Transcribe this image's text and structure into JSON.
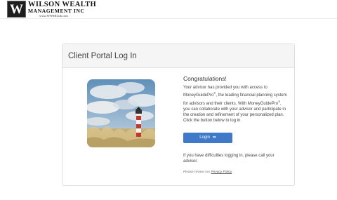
{
  "header": {
    "logo_mark": "W",
    "logo_line1": "WILSON WEALTH",
    "logo_line2": "MANAGEMENT INC",
    "logo_url": "www.WWMClub.com"
  },
  "card": {
    "title": "Client Portal Log In",
    "congrats": "Congratulations!",
    "desc_part1": "Your advisor has provided you with access to MoneyGuidePro",
    "desc_sup1": "®",
    "desc_part2": ", the leading financial planning system for advisors and their clients. With MoneyGuidePro",
    "desc_sup2": "®",
    "desc_part3": ", you can collaborate with your advisor and participate in the creation and refinement of your personalized plan. Click the button below to log in.",
    "login_label": "Login",
    "login_icon": "login-arrow-icon",
    "help_text": "If you have difficulties logging in, please call your advisor.",
    "privacy_prefix": "Please review our ",
    "privacy_link": "Privacy Policy"
  },
  "colors": {
    "button": "#3f79c8",
    "panel_header": "#f5f5f5"
  }
}
